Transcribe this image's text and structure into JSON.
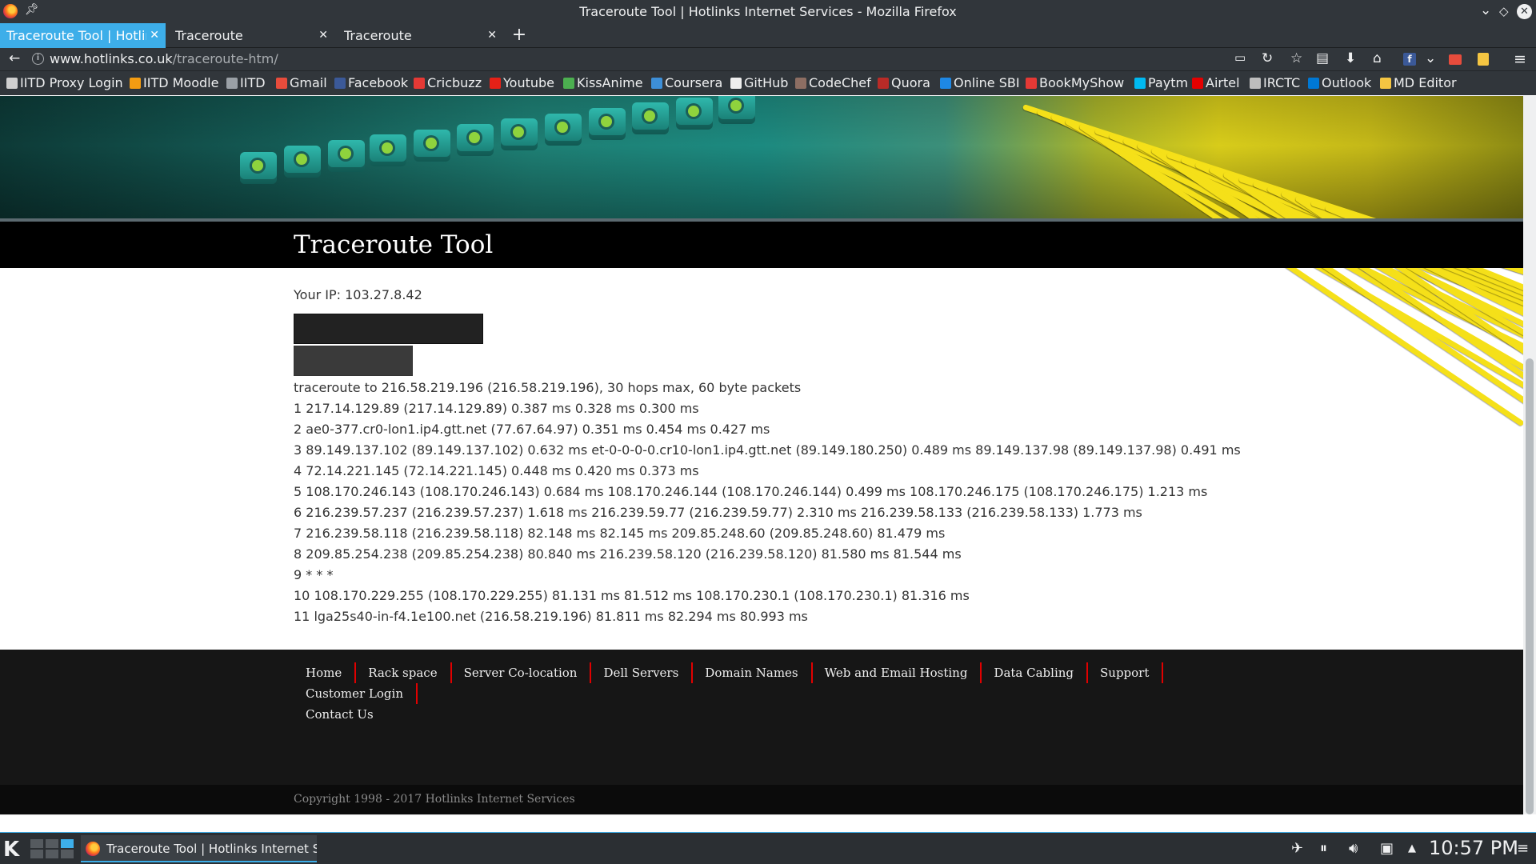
{
  "window": {
    "title": "Traceroute Tool | Hotlinks Internet Services - Mozilla Firefox"
  },
  "tabs": [
    {
      "label": "Traceroute Tool | Hotlinks Internet Services",
      "active": true
    },
    {
      "label": "Traceroute",
      "active": false
    },
    {
      "label": "Traceroute",
      "active": false
    }
  ],
  "navbar": {
    "url_host": "www.hotlinks.co.uk",
    "url_path": "/traceroute-htm/"
  },
  "bookmarks": [
    {
      "label": "IITD Proxy Login",
      "icon_color": "#cfcfcf"
    },
    {
      "label": "IITD Moodle",
      "icon_color": "#f39c12"
    },
    {
      "label": "IITD",
      "icon_color": "#9aa0a6"
    },
    {
      "label": "Gmail",
      "icon_color": "#e74c3c"
    },
    {
      "label": "Facebook",
      "icon_color": "#3b5998"
    },
    {
      "label": "Cricbuzz",
      "icon_color": "#e53935"
    },
    {
      "label": "Youtube",
      "icon_color": "#e62117"
    },
    {
      "label": "KissAnime",
      "icon_color": "#4caf50"
    },
    {
      "label": "Coursera",
      "icon_color": "#3d8fd8"
    },
    {
      "label": "GitHub",
      "icon_color": "#eeeeee"
    },
    {
      "label": "CodeChef",
      "icon_color": "#8d6e63"
    },
    {
      "label": "Quora",
      "icon_color": "#b92b27"
    },
    {
      "label": "Online SBI",
      "icon_color": "#1e88e5"
    },
    {
      "label": "BookMyShow",
      "icon_color": "#e53935"
    },
    {
      "label": "Paytm",
      "icon_color": "#00b9f1"
    },
    {
      "label": "Airtel",
      "icon_color": "#e40000"
    },
    {
      "label": "IRCTC",
      "icon_color": "#bdbdbd"
    },
    {
      "label": "Outlook",
      "icon_color": "#0078d4"
    },
    {
      "label": "MD Editor",
      "icon_color": "#f4c542"
    }
  ],
  "page": {
    "title": "Traceroute Tool",
    "your_ip": "Your IP: 103.27.8.42",
    "host_value": "",
    "traceroute_lines": [
      "traceroute to 216.58.219.196 (216.58.219.196), 30 hops max, 60 byte packets",
      "1 217.14.129.89 (217.14.129.89) 0.387 ms 0.328 ms 0.300 ms",
      "2 ae0-377.cr0-lon1.ip4.gtt.net (77.67.64.97) 0.351 ms 0.454 ms 0.427 ms",
      "3 89.149.137.102 (89.149.137.102) 0.632 ms et-0-0-0-0.cr10-lon1.ip4.gtt.net (89.149.180.250) 0.489 ms 89.149.137.98 (89.149.137.98) 0.491 ms",
      "4 72.14.221.145 (72.14.221.145) 0.448 ms 0.420 ms 0.373 ms",
      "5 108.170.246.143 (108.170.246.143) 0.684 ms 108.170.246.144 (108.170.246.144) 0.499 ms 108.170.246.175 (108.170.246.175) 1.213 ms",
      "6 216.239.57.237 (216.239.57.237) 1.618 ms 216.239.59.77 (216.239.59.77) 2.310 ms 216.239.58.133 (216.239.58.133) 1.773 ms",
      "7 216.239.58.118 (216.239.58.118) 82.148 ms 82.145 ms 209.85.248.60 (209.85.248.60) 81.479 ms",
      "8 209.85.254.238 (209.85.254.238) 80.840 ms 216.239.58.120 (216.239.58.120) 81.580 ms 81.544 ms",
      "9 * * *",
      "10 108.170.229.255 (108.170.229.255) 81.131 ms 81.512 ms 108.170.230.1 (108.170.230.1) 81.316 ms",
      "11 lga25s40-in-f4.1e100.net (216.58.219.196) 81.811 ms 82.294 ms 80.993 ms"
    ]
  },
  "footer": {
    "links": [
      "Home",
      "Rack space",
      "Server Co-location",
      "Dell Servers",
      "Domain Names",
      "Web and Email Hosting",
      "Data Cabling",
      "Support",
      "Customer Login",
      "Contact Us"
    ],
    "copyright": "Copyright 1998 - 2017 Hotlinks Internet Services"
  },
  "taskbar": {
    "task_label": "Traceroute Tool | Hotlinks Internet Services - Mozilla Firefox",
    "clock": "10:57 PM"
  },
  "colors": {
    "accent": "#3daee9",
    "footer_divider": "#e00000",
    "title_band": "#000000"
  }
}
